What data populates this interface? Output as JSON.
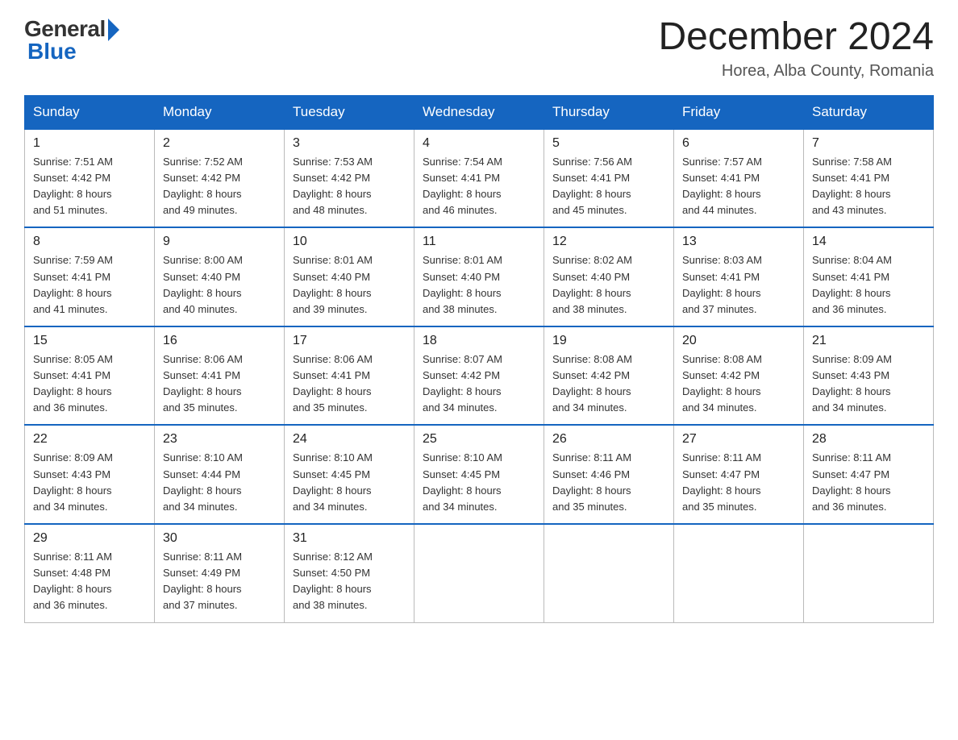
{
  "logo": {
    "general": "General",
    "blue": "Blue"
  },
  "header": {
    "month": "December 2024",
    "location": "Horea, Alba County, Romania"
  },
  "days_of_week": [
    "Sunday",
    "Monday",
    "Tuesday",
    "Wednesday",
    "Thursday",
    "Friday",
    "Saturday"
  ],
  "weeks": [
    [
      {
        "day": "1",
        "sunrise": "7:51 AM",
        "sunset": "4:42 PM",
        "daylight": "8 hours and 51 minutes."
      },
      {
        "day": "2",
        "sunrise": "7:52 AM",
        "sunset": "4:42 PM",
        "daylight": "8 hours and 49 minutes."
      },
      {
        "day": "3",
        "sunrise": "7:53 AM",
        "sunset": "4:42 PM",
        "daylight": "8 hours and 48 minutes."
      },
      {
        "day": "4",
        "sunrise": "7:54 AM",
        "sunset": "4:41 PM",
        "daylight": "8 hours and 46 minutes."
      },
      {
        "day": "5",
        "sunrise": "7:56 AM",
        "sunset": "4:41 PM",
        "daylight": "8 hours and 45 minutes."
      },
      {
        "day": "6",
        "sunrise": "7:57 AM",
        "sunset": "4:41 PM",
        "daylight": "8 hours and 44 minutes."
      },
      {
        "day": "7",
        "sunrise": "7:58 AM",
        "sunset": "4:41 PM",
        "daylight": "8 hours and 43 minutes."
      }
    ],
    [
      {
        "day": "8",
        "sunrise": "7:59 AM",
        "sunset": "4:41 PM",
        "daylight": "8 hours and 41 minutes."
      },
      {
        "day": "9",
        "sunrise": "8:00 AM",
        "sunset": "4:40 PM",
        "daylight": "8 hours and 40 minutes."
      },
      {
        "day": "10",
        "sunrise": "8:01 AM",
        "sunset": "4:40 PM",
        "daylight": "8 hours and 39 minutes."
      },
      {
        "day": "11",
        "sunrise": "8:01 AM",
        "sunset": "4:40 PM",
        "daylight": "8 hours and 38 minutes."
      },
      {
        "day": "12",
        "sunrise": "8:02 AM",
        "sunset": "4:40 PM",
        "daylight": "8 hours and 38 minutes."
      },
      {
        "day": "13",
        "sunrise": "8:03 AM",
        "sunset": "4:41 PM",
        "daylight": "8 hours and 37 minutes."
      },
      {
        "day": "14",
        "sunrise": "8:04 AM",
        "sunset": "4:41 PM",
        "daylight": "8 hours and 36 minutes."
      }
    ],
    [
      {
        "day": "15",
        "sunrise": "8:05 AM",
        "sunset": "4:41 PM",
        "daylight": "8 hours and 36 minutes."
      },
      {
        "day": "16",
        "sunrise": "8:06 AM",
        "sunset": "4:41 PM",
        "daylight": "8 hours and 35 minutes."
      },
      {
        "day": "17",
        "sunrise": "8:06 AM",
        "sunset": "4:41 PM",
        "daylight": "8 hours and 35 minutes."
      },
      {
        "day": "18",
        "sunrise": "8:07 AM",
        "sunset": "4:42 PM",
        "daylight": "8 hours and 34 minutes."
      },
      {
        "day": "19",
        "sunrise": "8:08 AM",
        "sunset": "4:42 PM",
        "daylight": "8 hours and 34 minutes."
      },
      {
        "day": "20",
        "sunrise": "8:08 AM",
        "sunset": "4:42 PM",
        "daylight": "8 hours and 34 minutes."
      },
      {
        "day": "21",
        "sunrise": "8:09 AM",
        "sunset": "4:43 PM",
        "daylight": "8 hours and 34 minutes."
      }
    ],
    [
      {
        "day": "22",
        "sunrise": "8:09 AM",
        "sunset": "4:43 PM",
        "daylight": "8 hours and 34 minutes."
      },
      {
        "day": "23",
        "sunrise": "8:10 AM",
        "sunset": "4:44 PM",
        "daylight": "8 hours and 34 minutes."
      },
      {
        "day": "24",
        "sunrise": "8:10 AM",
        "sunset": "4:45 PM",
        "daylight": "8 hours and 34 minutes."
      },
      {
        "day": "25",
        "sunrise": "8:10 AM",
        "sunset": "4:45 PM",
        "daylight": "8 hours and 34 minutes."
      },
      {
        "day": "26",
        "sunrise": "8:11 AM",
        "sunset": "4:46 PM",
        "daylight": "8 hours and 35 minutes."
      },
      {
        "day": "27",
        "sunrise": "8:11 AM",
        "sunset": "4:47 PM",
        "daylight": "8 hours and 35 minutes."
      },
      {
        "day": "28",
        "sunrise": "8:11 AM",
        "sunset": "4:47 PM",
        "daylight": "8 hours and 36 minutes."
      }
    ],
    [
      {
        "day": "29",
        "sunrise": "8:11 AM",
        "sunset": "4:48 PM",
        "daylight": "8 hours and 36 minutes."
      },
      {
        "day": "30",
        "sunrise": "8:11 AM",
        "sunset": "4:49 PM",
        "daylight": "8 hours and 37 minutes."
      },
      {
        "day": "31",
        "sunrise": "8:12 AM",
        "sunset": "4:50 PM",
        "daylight": "8 hours and 38 minutes."
      },
      null,
      null,
      null,
      null
    ]
  ],
  "labels": {
    "sunrise": "Sunrise:",
    "sunset": "Sunset:",
    "daylight": "Daylight:"
  }
}
